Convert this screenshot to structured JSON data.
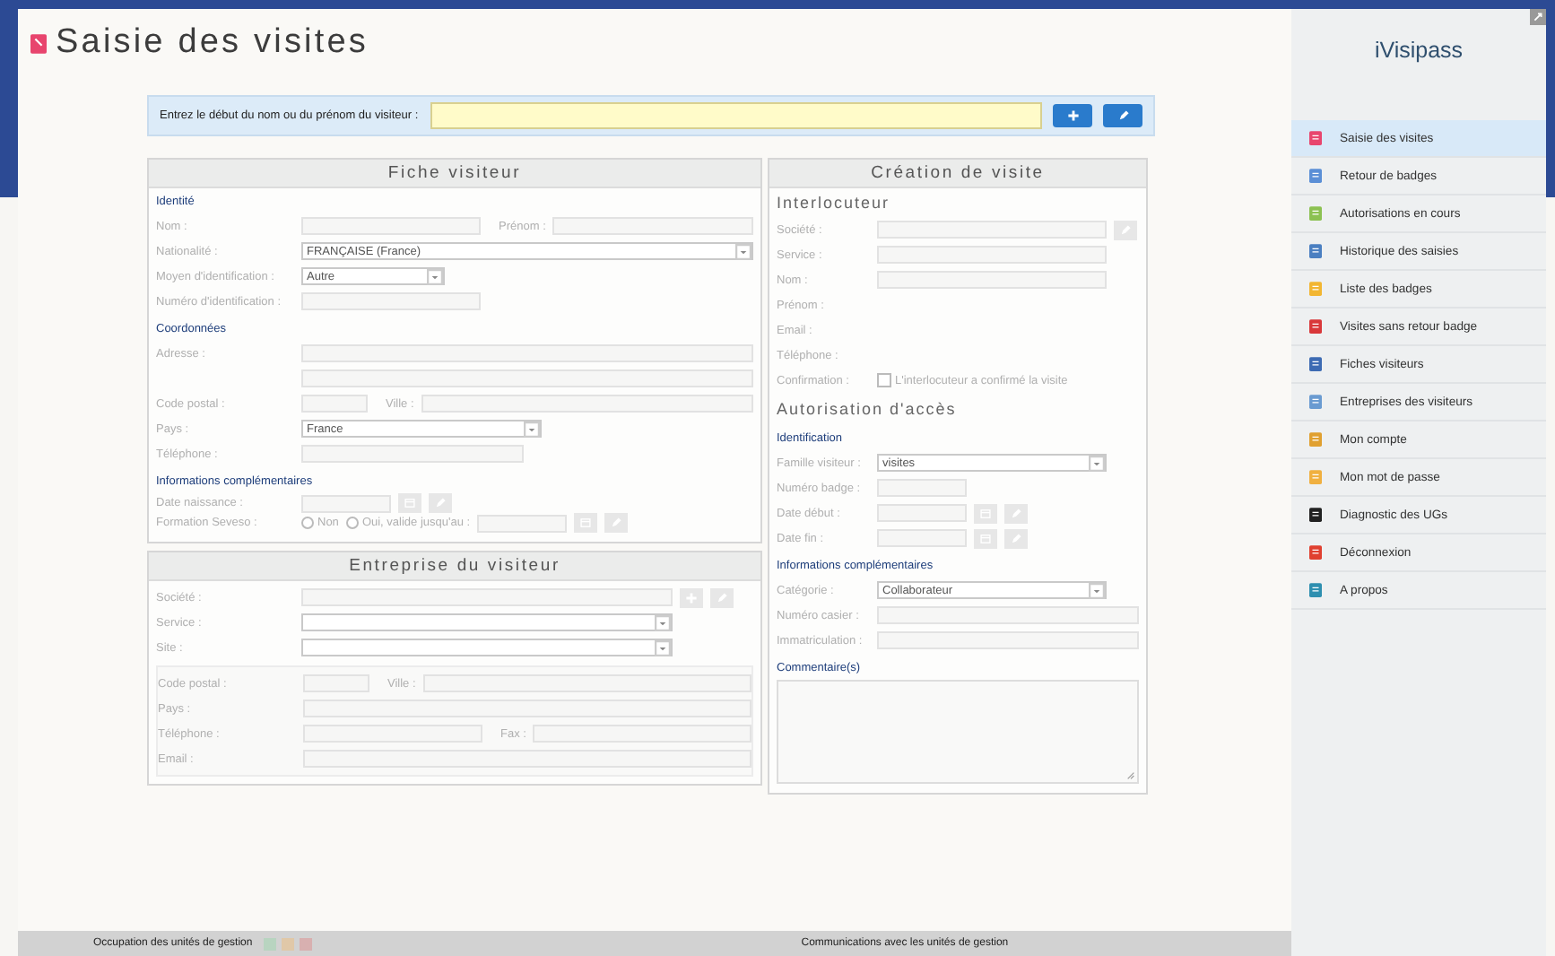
{
  "page_title": "Saisie des visites",
  "search": {
    "label": "Entrez le début du nom ou du prénom du visiteur :",
    "buttons": [
      {
        "kind": "add",
        "disabled": false
      },
      {
        "kind": "edit",
        "disabled": false
      }
    ]
  },
  "columns": [
    [
      {
        "title": "Fiche visiteur",
        "groups": [
          {
            "kind": "sub",
            "heading": "Identité",
            "rows": [
              [
                {
                  "kind": "label",
                  "text": "Nom :"
                },
                {
                  "kind": "input-medium"
                },
                {
                  "kind": "text",
                  "text": "Prénom :"
                },
                {
                  "kind": "input-full"
                }
              ],
              [
                {
                  "kind": "label",
                  "text": "Nationalité :"
                },
                {
                  "kind": "select-full",
                  "value": "FRANÇAISE (France)"
                }
              ],
              [
                {
                  "kind": "label",
                  "text": "Moyen d'identification :"
                },
                {
                  "kind": "select-short",
                  "value": "Autre"
                }
              ],
              [
                {
                  "kind": "label",
                  "text": "Numéro d'identification :"
                },
                {
                  "kind": "input-medium"
                }
              ]
            ]
          },
          {
            "kind": "sub",
            "heading": "Coordonnées",
            "rows": [
              [
                {
                  "kind": "label",
                  "text": "Adresse :"
                },
                {
                  "kind": "input-full"
                }
              ],
              [
                {
                  "kind": "label"
                },
                {
                  "kind": "input-full"
                }
              ],
              [
                {
                  "kind": "label",
                  "text": "Code postal :"
                },
                {
                  "kind": "input-tiny"
                },
                {
                  "kind": "text",
                  "text": "Ville :"
                },
                {
                  "kind": "input-full"
                }
              ],
              [
                {
                  "kind": "label",
                  "text": "Pays :"
                },
                {
                  "kind": "select-long",
                  "value": "France"
                }
              ],
              [
                {
                  "kind": "label",
                  "text": "Téléphone :"
                },
                {
                  "kind": "input-long"
                }
              ]
            ]
          },
          {
            "kind": "sub",
            "heading": "Informations complémentaires",
            "rows": [
              [
                {
                  "kind": "label",
                  "text": "Date naissance :"
                },
                {
                  "kind": "input-short"
                },
                {
                  "kind": "calendar",
                  "disabled": true
                },
                {
                  "kind": "edit",
                  "disabled": true
                }
              ],
              [
                {
                  "kind": "label",
                  "text": "Formation Seveso :"
                },
                {
                  "kind": "radio",
                  "text": "Non",
                  "selected": false
                },
                {
                  "kind": "radio",
                  "text": "Oui, valide jusqu'au :",
                  "selected": false
                },
                {
                  "kind": "input-short"
                },
                {
                  "kind": "calendar",
                  "disabled": true
                },
                {
                  "kind": "edit",
                  "disabled": true
                }
              ]
            ]
          }
        ]
      },
      {
        "title": "Entreprise du visiteur",
        "groups": [
          {
            "kind": "plain",
            "rows": [
              [
                {
                  "kind": "label",
                  "text": "Société :"
                },
                {
                  "kind": "input-wide"
                },
                {
                  "kind": "add",
                  "disabled": true
                },
                {
                  "kind": "edit",
                  "disabled": true
                }
              ],
              [
                {
                  "kind": "label",
                  "text": "Service :"
                },
                {
                  "kind": "select-wide"
                }
              ],
              [
                {
                  "kind": "label",
                  "text": "Site :"
                },
                {
                  "kind": "select-wide"
                }
              ]
            ]
          },
          {
            "kind": "inset",
            "rows": [
              [
                {
                  "kind": "label",
                  "text": "Code postal :"
                },
                {
                  "kind": "input-tiny"
                },
                {
                  "kind": "text",
                  "text": "Ville :"
                },
                {
                  "kind": "input-full"
                }
              ],
              [
                {
                  "kind": "label",
                  "text": "Pays :"
                },
                {
                  "kind": "input-full"
                }
              ],
              [
                {
                  "kind": "label",
                  "text": "Téléphone :"
                },
                {
                  "kind": "input-medium"
                },
                {
                  "kind": "text",
                  "text": "Fax :"
                },
                {
                  "kind": "input-full"
                }
              ],
              [
                {
                  "kind": "label",
                  "text": "Email :"
                },
                {
                  "kind": "input-full"
                }
              ]
            ]
          }
        ]
      }
    ],
    [
      {
        "title": "Création de visite",
        "groups": [
          {
            "kind": "section",
            "heading": "Interlocuteur",
            "rows": [
              [
                {
                  "kind": "label",
                  "text": "Société :"
                },
                {
                  "kind": "input-long"
                },
                {
                  "kind": "edit",
                  "disabled": true
                }
              ],
              [
                {
                  "kind": "label",
                  "text": "Service :"
                },
                {
                  "kind": "input-long"
                }
              ],
              [
                {
                  "kind": "label",
                  "text": "Nom :"
                },
                {
                  "kind": "input-long"
                }
              ],
              [
                {
                  "kind": "label",
                  "text": "Prénom :"
                }
              ],
              [
                {
                  "kind": "label",
                  "text": "Email :"
                }
              ],
              [
                {
                  "kind": "label",
                  "text": "Téléphone :"
                }
              ],
              [
                {
                  "kind": "label",
                  "text": "Confirmation :"
                },
                {
                  "kind": "checkbox",
                  "text": "L'interlocuteur a confirmé la visite",
                  "checked": false
                }
              ]
            ]
          },
          {
            "kind": "section",
            "heading": "Autorisation d'accès"
          },
          {
            "kind": "sub",
            "heading": "Identification",
            "rows": [
              [
                {
                  "kind": "label",
                  "text": "Famille visiteur :"
                },
                {
                  "kind": "select-long",
                  "value": "visites"
                }
              ],
              [
                {
                  "kind": "label",
                  "text": "Numéro badge :"
                },
                {
                  "kind": "input-short"
                }
              ],
              [
                {
                  "kind": "label",
                  "text": "Date début :"
                },
                {
                  "kind": "input-short"
                },
                {
                  "kind": "calendar",
                  "disabled": true
                },
                {
                  "kind": "edit",
                  "disabled": true
                }
              ],
              [
                {
                  "kind": "label",
                  "text": "Date fin :"
                },
                {
                  "kind": "input-short"
                },
                {
                  "kind": "calendar",
                  "disabled": true
                },
                {
                  "kind": "edit",
                  "disabled": true
                }
              ]
            ]
          },
          {
            "kind": "sub",
            "heading": "Informations complémentaires",
            "rows": [
              [
                {
                  "kind": "label",
                  "text": "Catégorie :"
                },
                {
                  "kind": "select-long",
                  "value": "Collaborateur"
                }
              ],
              [
                {
                  "kind": "label",
                  "text": "Numéro casier :"
                },
                {
                  "kind": "input-full"
                }
              ],
              [
                {
                  "kind": "label",
                  "text": "Immatriculation :"
                },
                {
                  "kind": "input-full"
                }
              ]
            ]
          },
          {
            "kind": "sub",
            "heading": "Commentaire(s)",
            "rows": [
              [
                {
                  "kind": "textarea"
                }
              ]
            ]
          }
        ]
      }
    ]
  ],
  "sidebar": {
    "title": "iVisipass",
    "items": [
      {
        "label": "Saisie des visites",
        "color": "#e8456e",
        "selected": true
      },
      {
        "label": "Retour de badges",
        "color": "#5b8fd6",
        "selected": false
      },
      {
        "label": "Autorisations en cours",
        "color": "#8cc152",
        "selected": false
      },
      {
        "label": "Historique des saisies",
        "color": "#4a7fc1",
        "selected": false
      },
      {
        "label": "Liste des badges",
        "color": "#f2b632",
        "selected": false
      },
      {
        "label": "Visites sans retour badge",
        "color": "#d9383a",
        "selected": false
      },
      {
        "label": "Fiches visiteurs",
        "color": "#3d6bb3",
        "selected": false
      },
      {
        "label": "Entreprises des visiteurs",
        "color": "#6a9bd1",
        "selected": false
      },
      {
        "label": "Mon compte",
        "color": "#e0a030",
        "selected": false
      },
      {
        "label": "Mon mot de passe",
        "color": "#f0b040",
        "selected": false
      },
      {
        "label": "Diagnostic des UGs",
        "color": "#222222",
        "selected": false
      },
      {
        "label": "Déconnexion",
        "color": "#e04030",
        "selected": false
      },
      {
        "label": "A propos",
        "color": "#2e8fb0",
        "selected": false
      }
    ]
  },
  "status_bar": {
    "left": "Occupation des unités de gestion",
    "indicators": [
      {
        "color": "#b8d4c0"
      },
      {
        "color": "#e0c8a8"
      },
      {
        "color": "#d8b0b0"
      }
    ],
    "right": "Communications avec les unités de gestion"
  }
}
